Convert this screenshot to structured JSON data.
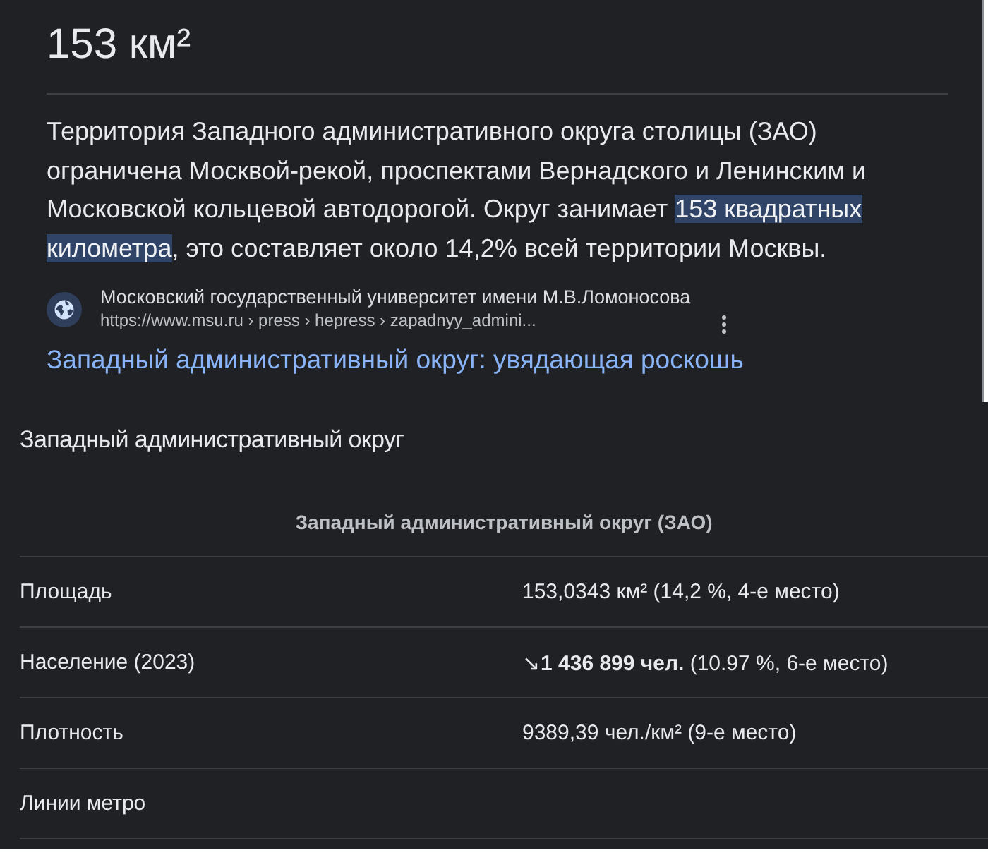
{
  "answer": {
    "title": "153 км²",
    "paragraph": [
      {
        "text": "Территория Западного административного округа столицы (ЗАО) ограничена Москвой-рекой, проспектами Вернадского и Ленинским и Московской кольцевой автодорогой. Округ занимает ",
        "highlighted": false
      },
      {
        "text": "153 квадратных километра",
        "highlighted": true
      },
      {
        "text": ", это составляет около 14,2% всей территории Москвы.",
        "highlighted": false
      }
    ]
  },
  "source": {
    "name": "Московский государственный университет имени М.В.Ломоносова",
    "url": "https://www.msu.ru › press › hepress › zapadnyy_admini...",
    "link_title": "Западный административный округ: увядающая роскошь"
  },
  "infobox": {
    "heading": "Западный административный округ",
    "table_title": "Западный административный округ (ЗАО)",
    "rows": [
      {
        "label": "Площадь",
        "value": "153,0343 км² (14,2 %, 4-е место)"
      },
      {
        "label": "Население (2023)",
        "value": "↘**1 436 899 чел.** (10.97 %, 6-е место)"
      },
      {
        "label": "Плотность",
        "value": "9389,39 чел./км² (9-е место)"
      },
      {
        "label": "Линии метро"
      }
    ]
  }
}
